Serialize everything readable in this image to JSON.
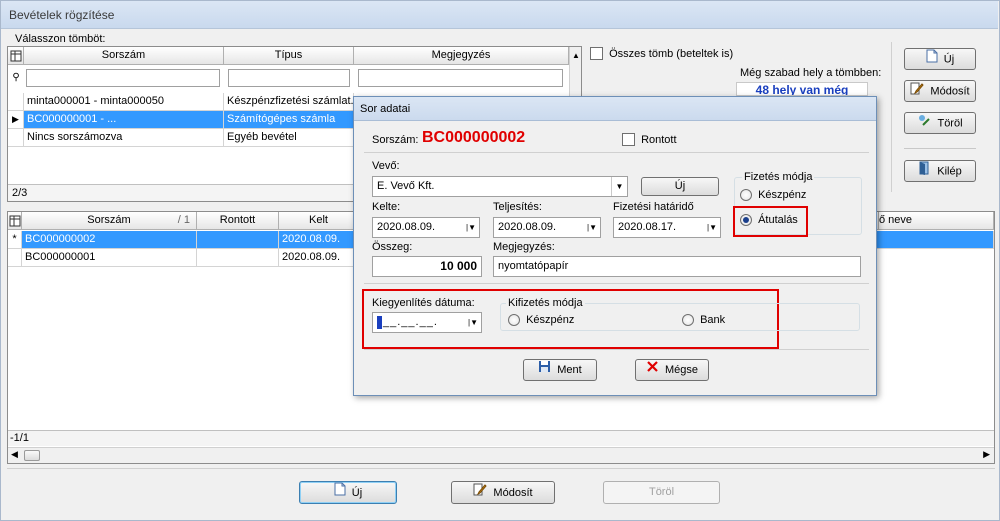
{
  "window": {
    "title": "Bevételek rögzítése"
  },
  "top_grid": {
    "label": "Válasszon tömböt:",
    "headers": [
      "Sorszám",
      "Típus",
      "Megjegyzés"
    ],
    "rows": [
      {
        "sorszam": "minta000001 - minta000050",
        "tipus": "Készpénzfizetési számlat..."
      },
      {
        "sorszam": "BC000000001 - ...",
        "tipus": "Számítógépes számla"
      },
      {
        "sorszam": "Nincs sorszámozva",
        "tipus": "Egyéb bevétel"
      }
    ],
    "counter": "2/3"
  },
  "options": {
    "osszes_tomb": "Összes tömb (beteltek is)",
    "free_space_label": "Még szabad hely a tömbben:",
    "free_space_value": "48 hely van még"
  },
  "side_buttons": {
    "new": "Új",
    "modify": "Módosít",
    "delete": "Töröl",
    "exit": "Kilép"
  },
  "bottom_grid": {
    "headers": {
      "sorszam": "Sorszám",
      "sort": "/ 1",
      "rontott": "Rontott",
      "kelt": "Kelt",
      "partner_neve": "ő neve"
    },
    "rows": [
      {
        "marker": "*",
        "sorszam": "BC000000002",
        "kelt": "2020.08.09."
      },
      {
        "marker": "",
        "sorszam": "BC000000001",
        "kelt": "2020.08.09."
      }
    ],
    "counter": "-1/1"
  },
  "bottom_buttons": {
    "new": "Új",
    "modify": "Módosít",
    "delete": "Töröl"
  },
  "dialog": {
    "title": "Sor adatai",
    "sorszam_label": "Sorszám:",
    "sorszam_value": "BC000000002",
    "rontott": "Rontott",
    "vevo_label": "Vevő:",
    "vevo_value": "E. Vevő Kft.",
    "uj": "Új",
    "kelte_label": "Kelte:",
    "kelte_value": "2020.08.09.",
    "teljesites_label": "Teljesítés:",
    "teljesites_value": "2020.08.09.",
    "hatarido_label": "Fizetési határidő",
    "hatarido_value": "2020.08.17.",
    "osszeg_label": "Összeg:",
    "osszeg_value": "10 000",
    "megjegyzes_label": "Megjegyzés:",
    "megjegyzes_value": "nyomtatópapír",
    "fizetes_mod_label": "Fizetés módja",
    "fizetes_keszpenz": "Készpénz",
    "fizetes_atutalas": "Átutalás",
    "kiegy_label": "Kiegyenlítés dátuma:",
    "kiegy_value": "__.__.__.",
    "kifizetes_label": "Kifizetés módja",
    "kifizetes_keszpenz": "Készpénz",
    "kifizetes_bank": "Bank",
    "ment": "Ment",
    "megse": "Mégse"
  },
  "colors": {
    "selection": "#3399ff",
    "highlight_red": "#e00000",
    "sorszam_red": "#e00000",
    "link_blue": "#1a3fbf"
  }
}
